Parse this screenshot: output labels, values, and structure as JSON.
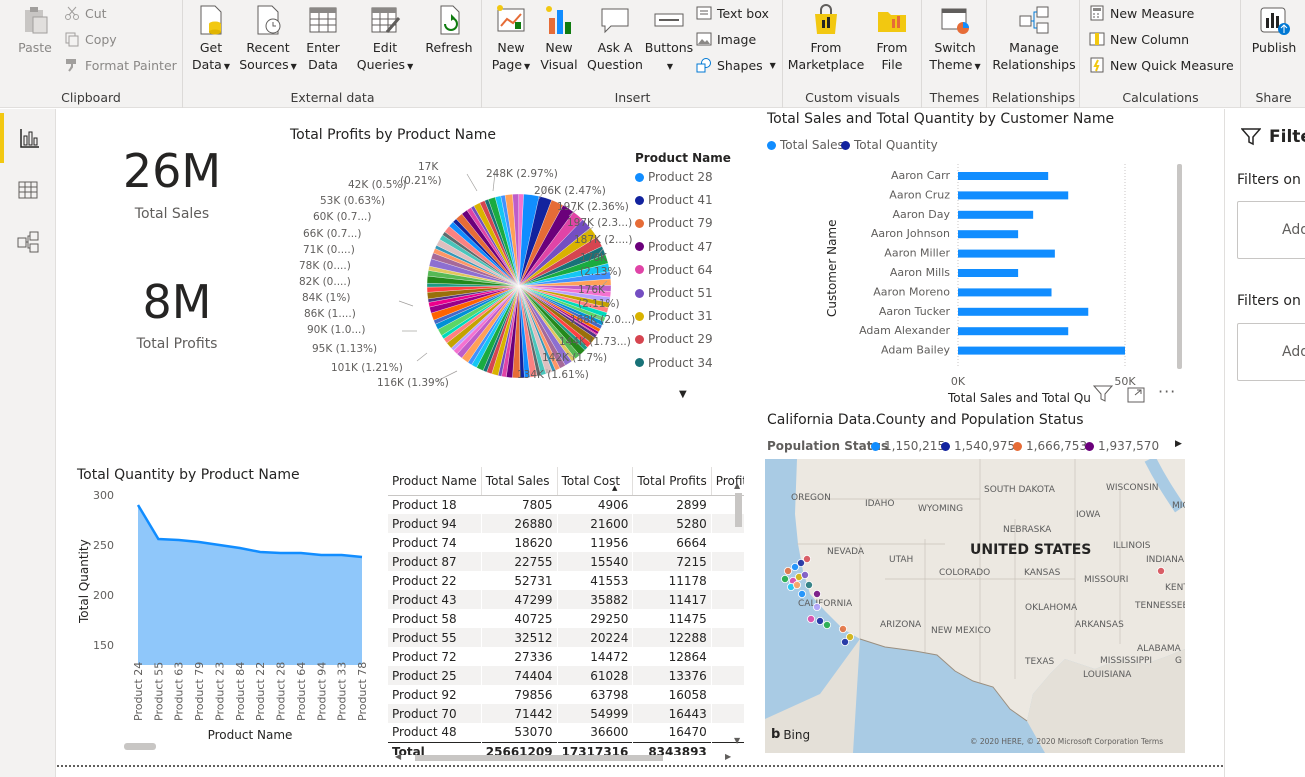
{
  "ribbon": {
    "clipboard": {
      "label": "Clipboard",
      "paste": "Paste",
      "cut": "Cut",
      "copy": "Copy",
      "format_painter": "Format Painter"
    },
    "external": {
      "label": "External data",
      "get_data": [
        "Get",
        "Data"
      ],
      "recent": [
        "Recent",
        "Sources"
      ],
      "enter": [
        "Enter",
        "Data"
      ],
      "edit": [
        "Edit",
        "Queries"
      ],
      "refresh": "Refresh"
    },
    "insert": {
      "label": "Insert",
      "new_page": [
        "New",
        "Page"
      ],
      "new_visual": [
        "New",
        "Visual"
      ],
      "ask": [
        "Ask A",
        "Question"
      ],
      "buttons": "Buttons",
      "text_box": "Text box",
      "image": "Image",
      "shapes": "Shapes"
    },
    "custom": {
      "label": "Custom visuals",
      "marketplace": [
        "From",
        "Marketplace"
      ],
      "file": [
        "From",
        "File"
      ]
    },
    "themes": {
      "label": "Themes",
      "switch": [
        "Switch",
        "Theme"
      ]
    },
    "relationships": {
      "label": "Relationships",
      "manage": [
        "Manage",
        "Relationships"
      ]
    },
    "calculations": {
      "label": "Calculations",
      "new_measure": "New Measure",
      "new_column": "New Column",
      "new_quick": "New Quick Measure"
    },
    "share": {
      "label": "Share",
      "publish": "Publish"
    }
  },
  "cards": {
    "sales_value": "26M",
    "sales_label": "Total Sales",
    "profits_value": "8M",
    "profits_label": "Total Profits"
  },
  "pie": {
    "title": "Total Profits by Product Name",
    "legend_title": "Product Name",
    "legend": [
      "Product 28",
      "Product 41",
      "Product 79",
      "Product 47",
      "Product 64",
      "Product 51",
      "Product 31",
      "Product 29",
      "Product 34"
    ],
    "legend_colors": [
      "#118dff",
      "#12239e",
      "#e66c37",
      "#6b007b",
      "#e044a7",
      "#744ec2",
      "#d9b300",
      "#d64550",
      "#197278"
    ],
    "labels_right": [
      "248K (2.97%)",
      "206K (2.47%)",
      "197K (2.36%)",
      "197K (2.3...)",
      "187K (2....)",
      "178K",
      "(2.13%)",
      "176K",
      "(2.11%)",
      "168K (2.0...)",
      "144K (1.73...)",
      "142K (1.7%)",
      "134K (1.61%)"
    ],
    "labels_left": [
      "17K",
      "(0.21%)",
      "42K (0.5%)",
      "53K (0.63%)",
      "60K (0.7...)",
      "66K (0.7...)",
      "71K (0....)",
      "78K (0....)",
      "82K (0....)",
      "84K (1%)",
      "86K (1....)",
      "90K (1.0...)",
      "95K (1.13%)",
      "101K (1.21%)",
      "116K (1.39%)"
    ]
  },
  "bar": {
    "title": "Total Sales and Total Quantity by Customer Name",
    "legend": [
      "Total Sales",
      "Total Quantity"
    ],
    "ylabel": "Customer Name",
    "xlabel": "Total Sales and Total Qu",
    "ticks": [
      "0K",
      "50K"
    ]
  },
  "line": {
    "title": "Total Quantity by Product Name",
    "ylabel": "Total Quantity",
    "xlabel": "Product Name",
    "yticks": [
      "300",
      "250",
      "200",
      "150"
    ]
  },
  "table": {
    "headers": [
      "Product Name",
      "Total Sales",
      "Total Cost",
      "Total Profits",
      "Profit Ma"
    ],
    "rows": [
      [
        "Product 18",
        "7805",
        "4906",
        "2899"
      ],
      [
        "Product 94",
        "26880",
        "21600",
        "5280"
      ],
      [
        "Product 74",
        "18620",
        "11956",
        "6664"
      ],
      [
        "Product 87",
        "22755",
        "15540",
        "7215"
      ],
      [
        "Product 22",
        "52731",
        "41553",
        "11178"
      ],
      [
        "Product 43",
        "47299",
        "35882",
        "11417"
      ],
      [
        "Product 58",
        "40725",
        "29250",
        "11475"
      ],
      [
        "Product 55",
        "32512",
        "20224",
        "12288"
      ],
      [
        "Product 72",
        "27336",
        "14472",
        "12864"
      ],
      [
        "Product 25",
        "74404",
        "61028",
        "13376"
      ],
      [
        "Product 92",
        "79856",
        "63798",
        "16058"
      ],
      [
        "Product 70",
        "71442",
        "54999",
        "16443"
      ],
      [
        "Product 48",
        "53070",
        "36600",
        "16470"
      ]
    ],
    "total": [
      "Total",
      "25661209",
      "17317316",
      "8343893"
    ]
  },
  "map": {
    "title": "California Data.County and Population Status",
    "legend_title": "Population Status",
    "legend": [
      "1,150,215",
      "1,540,975",
      "1,666,753",
      "1,937,570"
    ],
    "legend_colors": [
      "#118dff",
      "#12239e",
      "#e66c37",
      "#6b007b"
    ],
    "country": "UNITED STATES",
    "states": [
      "OREGON",
      "IDAHO",
      "WYOMING",
      "SOUTH DAKOTA",
      "WISCONSIN",
      "MICH",
      "IOWA",
      "NEBRASKA",
      "ILLINOIS",
      "NEVADA",
      "UTAH",
      "COLORADO",
      "KANSAS",
      "MISSOURI",
      "INDIANA",
      "KENTU",
      "CALIFORNIA",
      "OKLAHOMA",
      "TENNESSEE",
      "ARIZONA",
      "NEW MEXICO",
      "ARKANSAS",
      "ALABAMA",
      "TEXAS",
      "MISSISSIPPI",
      "G",
      "LOUISIANA"
    ],
    "bing": "Bing",
    "copyright": "© 2020 HERE, © 2020 Microsoft Corporation Terms"
  },
  "filters": {
    "title": "Filte",
    "on_page": "Filters on t",
    "on_all": "Filters on a",
    "add": "Add"
  },
  "chart_data": [
    {
      "type": "pie",
      "title": "Total Profits by Product Name",
      "series_name": "Product Name",
      "categories": [
        "Product 28",
        "Product 41",
        "Product 79",
        "Product 47",
        "Product 64",
        "Product 51",
        "Product 31",
        "Product 29",
        "Product 34"
      ],
      "values": [
        248000,
        206000,
        197000,
        197000,
        187000,
        178000,
        176000,
        168000,
        144000,
        142000,
        134000,
        116000,
        101000,
        95000,
        90000,
        86000,
        84000,
        82000,
        78000,
        71000,
        66000,
        60000,
        53000,
        42000,
        17000
      ]
    },
    {
      "type": "bar",
      "title": "Total Sales and Total Quantity by Customer Name",
      "categories": [
        "Aaron Carr",
        "Aaron Cruz",
        "Aaron Day",
        "Aaron Johnson",
        "Aaron Miller",
        "Aaron Mills",
        "Aaron Moreno",
        "Aaron Tucker",
        "Adam Alexander",
        "Adam Bailey"
      ],
      "series": [
        {
          "name": "Total Sales",
          "values": [
            27000,
            33000,
            22500,
            18000,
            29000,
            18000,
            28000,
            39000,
            33000,
            50000
          ]
        }
      ],
      "ylabel": "Customer Name",
      "xlim": [
        0,
        60000
      ]
    },
    {
      "type": "area",
      "title": "Total Quantity by Product Name",
      "categories": [
        "Product 24",
        "Product 55",
        "Product 63",
        "Product 79",
        "Product 23",
        "Product 84",
        "Product 22",
        "Product 28",
        "Product 64",
        "Product 94",
        "Product 33",
        "Product 78"
      ],
      "values": [
        290,
        256,
        255,
        253,
        250,
        247,
        243,
        242,
        242,
        240,
        240,
        238
      ],
      "xlabel": "Product Name",
      "ylabel": "Total Quantity",
      "ylim": [
        130,
        300
      ]
    },
    {
      "type": "scatter",
      "title": "California Data.County and Population Status",
      "series_name": "Population Status",
      "categories": [
        "1,150,215",
        "1,540,975",
        "1,666,753",
        "1,937,570"
      ]
    }
  ]
}
